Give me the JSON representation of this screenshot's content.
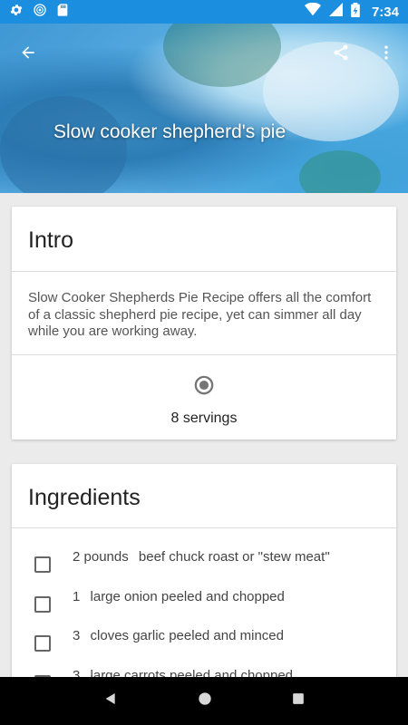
{
  "status_bar": {
    "time": "7:34",
    "icons_left": [
      "settings-icon",
      "globe-icon",
      "sd-card-icon"
    ],
    "icons_right": [
      "wifi-icon",
      "signal-icon",
      "battery-icon"
    ],
    "bg_color": "#1b8ee0"
  },
  "header": {
    "title": "Slow cooker shepherd's pie",
    "back_icon": "arrow-back-icon",
    "share_icon": "share-icon",
    "more_icon": "more-vert-icon"
  },
  "intro": {
    "title": "Intro",
    "text": "Slow Cooker Shepherds Pie Recipe offers all the comfort of a classic shepherd pie recipe, yet can simmer all day while you are working away.",
    "servings_icon": "radio-button-icon",
    "servings": "8 servings"
  },
  "ingredients": {
    "title": "Ingredients",
    "items": [
      {
        "qty": "2 pounds",
        "name": "beef chuck roast or \"stew meat\""
      },
      {
        "qty": "1",
        "name": "large onion peeled and chopped"
      },
      {
        "qty": "3",
        "name": "cloves garlic peeled and minced"
      },
      {
        "qty": "3",
        "name": "large carrots peeled and chopped"
      }
    ]
  },
  "nav_bar": {
    "back_icon": "nav-back-icon",
    "home_icon": "nav-home-icon",
    "recents_icon": "nav-recents-icon"
  }
}
